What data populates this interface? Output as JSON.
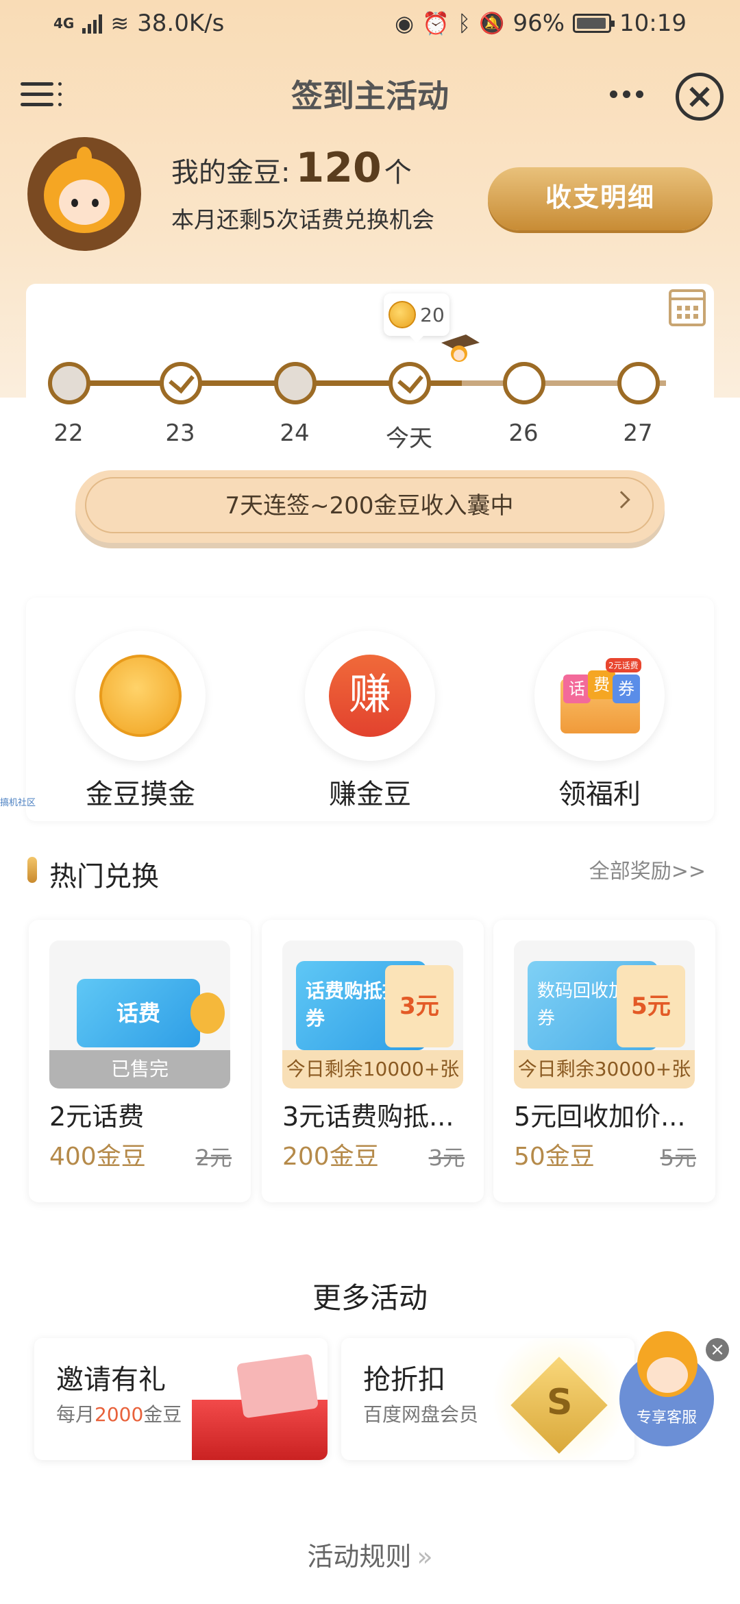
{
  "status_bar": {
    "network": "4G",
    "speed": "38.0K/s",
    "battery": "96%",
    "time": "10:19"
  },
  "header": {
    "title": "签到主活动"
  },
  "profile": {
    "coins_label": "我的金豆:",
    "coins_value": "120",
    "coins_unit": "个",
    "remaining_text": "本月还剩5次话费兑换机会",
    "detail_button": "收支明细"
  },
  "sign_in": {
    "reward_amount": "20",
    "days": [
      {
        "label": "22",
        "state": "gray"
      },
      {
        "label": "23",
        "state": "checked"
      },
      {
        "label": "24",
        "state": "gray"
      },
      {
        "label": "今天",
        "state": "checked"
      },
      {
        "label": "26",
        "state": "open"
      },
      {
        "label": "27",
        "state": "open"
      }
    ],
    "streak_text": "7天连签~200金豆收入囊中"
  },
  "features": [
    {
      "label": "金豆摸金",
      "icon": "coin-icon"
    },
    {
      "label": "赚金豆",
      "icon": "earn-icon",
      "glyph": "赚"
    },
    {
      "label": "领福利",
      "icon": "gift-box-icon",
      "tickets": [
        "话",
        "费",
        "券"
      ],
      "tag": "2元话费"
    }
  ],
  "watermark": "搞机社区",
  "hot_exchange": {
    "title": "热门兑换",
    "more_link": "全部奖励>>",
    "items": [
      {
        "ticket_text": "话费",
        "badge": "已售完",
        "name": "2元话费",
        "price": "400金豆",
        "original": "2元"
      },
      {
        "ticket_text": "话费购抵扣券",
        "stub": "3元",
        "badge": "今日剩余10000+张",
        "name": "3元话费购抵...",
        "price": "200金豆",
        "original": "3元"
      },
      {
        "ticket_text": "数码回收加价券",
        "stub": "5元",
        "badge": "今日剩余30000+张",
        "name": "5元回收加价...",
        "price": "50金豆",
        "original": "5元"
      }
    ]
  },
  "more_activities": {
    "title": "更多活动",
    "items": [
      {
        "title": "邀请有礼",
        "sub_prefix": "每月",
        "sub_highlight": "2000",
        "sub_suffix": "金豆"
      },
      {
        "title": "抢折扣",
        "sub": "百度网盘会员",
        "badge_letter": "S"
      }
    ]
  },
  "service": {
    "label": "专享客服"
  },
  "footer": {
    "rules": "活动规则",
    "chevron": "»"
  },
  "colors": {
    "accent_gold": "#c88c35",
    "highlight_red": "#e8613a",
    "header_bg": "#f9dcb6"
  }
}
